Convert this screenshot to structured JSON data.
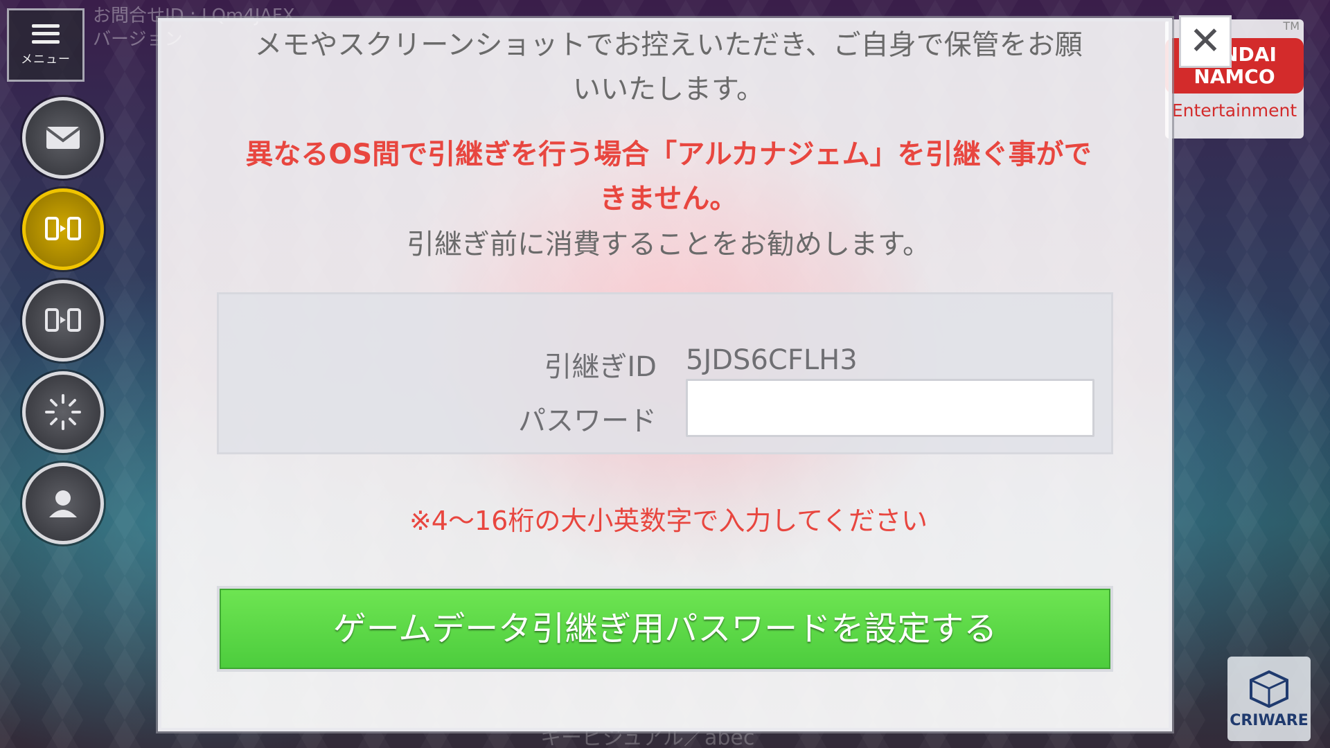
{
  "background": {
    "info_line1": "お問合せID : LQm4JAFX",
    "info_line2": "バージョン",
    "caption": "キービジュアル／abec"
  },
  "menu": {
    "label": "メニュー"
  },
  "side_buttons": [
    {
      "icon": "mail-icon",
      "active": false
    },
    {
      "icon": "transfer-icon",
      "active": true
    },
    {
      "icon": "transfer-icon",
      "active": false
    },
    {
      "icon": "loading-icon",
      "active": false
    },
    {
      "icon": "profile-icon",
      "active": false
    }
  ],
  "logos": {
    "bandai_tm": "TM",
    "bandai_name": "BANDAI NAMCO",
    "bandai_sub": "Entertainment",
    "criware": "CRIWARE"
  },
  "dialog": {
    "message_line1": "メモやスクリーンショットでお控えいただき、ご自身で保管をお願",
    "message_line2": "いいたします。",
    "warning_line1": "異なるOS間で引継ぎを行う場合「アルカナジェム」を引継ぐ事がで",
    "warning_line2": "きません。",
    "advice": "引継ぎ前に消費することをお勧めします。",
    "transfer_id_label": "引継ぎID",
    "transfer_id_value": "5JDS6CFLH3",
    "password_label": "パスワード",
    "password_value": "",
    "note": "※4～16桁の大小英数字で入力してください",
    "set_button": "ゲームデータ引継ぎ用パスワードを設定する"
  },
  "close_button": {
    "icon": "close-icon",
    "glyph": "✕"
  },
  "colors": {
    "warning": "#e8463f",
    "button_green": "#5ad846",
    "active_gold": "#f0c400"
  }
}
